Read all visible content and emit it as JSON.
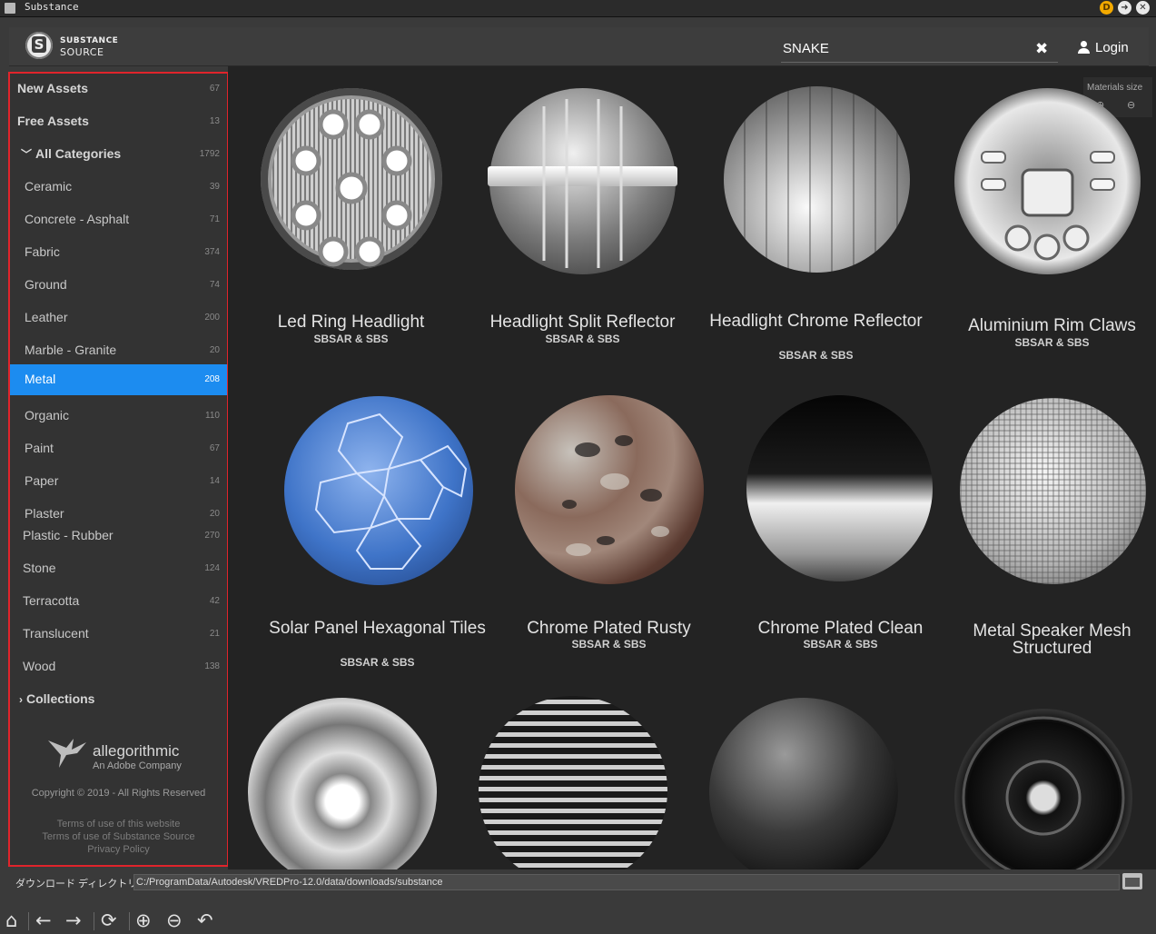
{
  "window": {
    "title": "Substance",
    "badge": "D"
  },
  "header": {
    "logo_line1": "SUBSTANCE",
    "logo_line2": "SOURCE",
    "search_value": "SNAKE",
    "clear_icon": "✖",
    "login_label": "Login"
  },
  "sidebar": {
    "new_assets": {
      "label": "New Assets",
      "count": "67"
    },
    "free_assets": {
      "label": "Free Assets",
      "count": "13"
    },
    "all_categories": {
      "label": "All Categories",
      "count": "1792"
    },
    "categories": [
      {
        "label": "Ceramic",
        "count": "39"
      },
      {
        "label": "Concrete - Asphalt",
        "count": "71"
      },
      {
        "label": "Fabric",
        "count": "374"
      },
      {
        "label": "Ground",
        "count": "74"
      },
      {
        "label": "Leather",
        "count": "200"
      },
      {
        "label": "Marble - Granite",
        "count": "20"
      },
      {
        "label": "Metal",
        "count": "208"
      },
      {
        "label": "Organic",
        "count": "110"
      },
      {
        "label": "Paint",
        "count": "67"
      },
      {
        "label": "Paper",
        "count": "14"
      },
      {
        "label": "Plaster",
        "count": "20"
      },
      {
        "label": "Plastic - Rubber",
        "count": "270"
      },
      {
        "label": "Stone",
        "count": "124"
      },
      {
        "label": "Terracotta",
        "count": "42"
      },
      {
        "label": "Translucent",
        "count": "21"
      },
      {
        "label": "Wood",
        "count": "138"
      }
    ],
    "active_category": "Metal",
    "collections_label": "Collections",
    "brand_name": "allegorithmic",
    "brand_sub": "An Adobe Company",
    "copyright": "Copyright © 2019 - All Rights Reserved",
    "links": [
      "Terms of use of this website",
      "Terms of use of Substance Source",
      "Privacy Policy"
    ]
  },
  "materials_size": {
    "label": "Materials size"
  },
  "materials": [
    {
      "name": "Led Ring Headlight",
      "format": "SBSAR & SBS"
    },
    {
      "name": "Headlight Split Reflector",
      "format": "SBSAR & SBS"
    },
    {
      "name": "Headlight Chrome Reflector",
      "format": "SBSAR & SBS"
    },
    {
      "name": "Aluminium Rim Claws",
      "format": "SBSAR & SBS"
    },
    {
      "name": "Solar Panel Hexagonal Tiles",
      "format": "SBSAR & SBS"
    },
    {
      "name": "Chrome Plated Rusty",
      "format": "SBSAR & SBS"
    },
    {
      "name": "Chrome Plated Clean",
      "format": "SBSAR & SBS"
    },
    {
      "name": "Metal Speaker Mesh Structured",
      "format": ""
    }
  ],
  "download": {
    "label": "ダウンロード ディレクトリ(D)",
    "path": "C:/ProgramData/Autodesk/VREDPro-12.0/data/downloads/substance"
  },
  "colors": {
    "accent": "#1c8cf0",
    "highlight_border": "#e0242b"
  }
}
